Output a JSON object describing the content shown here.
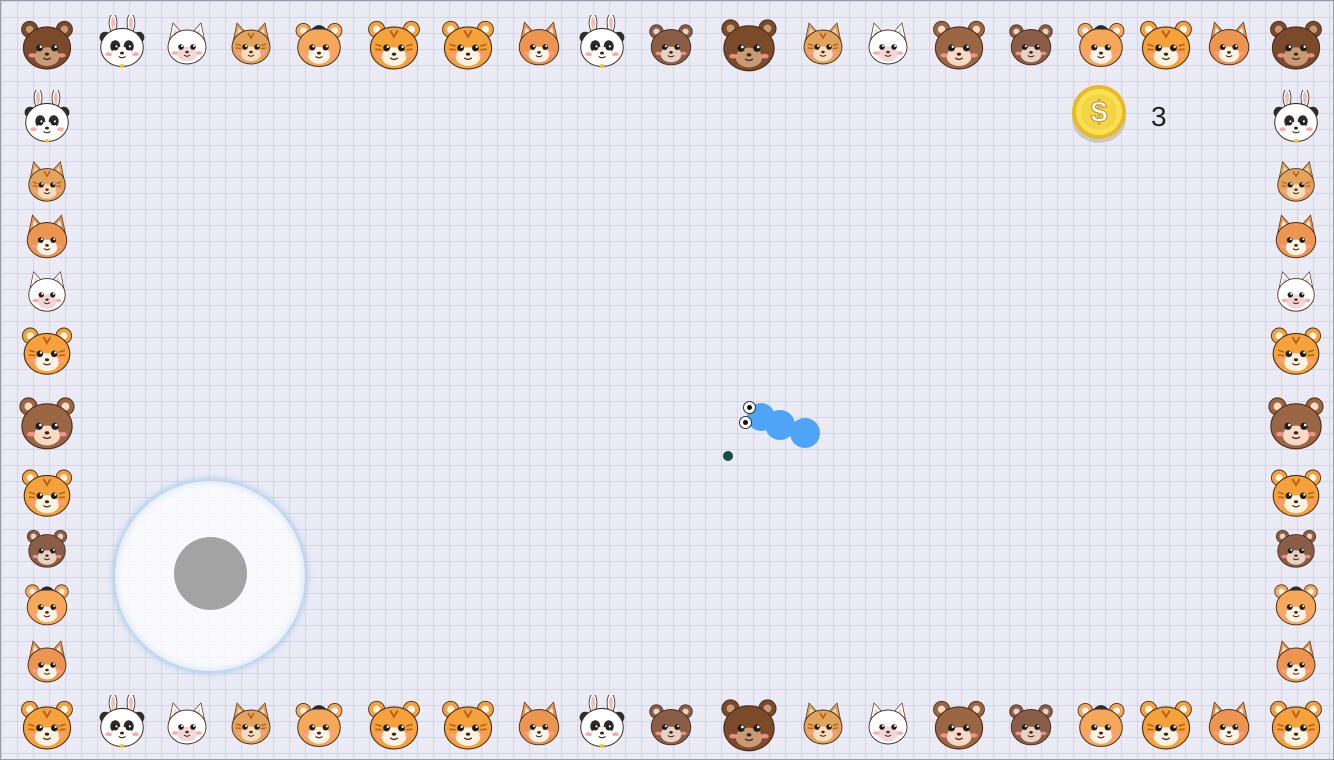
{
  "hud": {
    "coin_icon": "dollar-coin-icon",
    "coin_symbol": "$",
    "coin_count": "3"
  },
  "colors": {
    "background": "#ebebf6",
    "grid_line": "#d3d5e4",
    "snake": "#4ea4f7",
    "food": "#0e4e46",
    "joystick_knob": "#a3a3a3",
    "coin": "#f4d545"
  },
  "snake": {
    "segments": 3
  },
  "border_animals": {
    "top": [
      "bear",
      "panda-bunny",
      "white-cat",
      "tabby-cat",
      "hamster",
      "tiger",
      "tiger",
      "fox",
      "panda-bunny",
      "otter",
      "bear",
      "tabby-cat",
      "white-cat",
      "brown-bear",
      "otter",
      "hamster",
      "tiger",
      "fox",
      "bear"
    ],
    "bottom": [
      "tiger",
      "panda-bunny",
      "white-cat",
      "tabby-cat",
      "hamster",
      "tiger",
      "tiger",
      "fox",
      "panda-bunny",
      "otter",
      "bear",
      "tabby-cat",
      "white-cat",
      "brown-bear",
      "otter",
      "hamster",
      "tiger",
      "fox",
      "tiger"
    ],
    "left": [
      "panda-bunny",
      "tabby-cat",
      "fox",
      "white-cat",
      "tiger",
      "brown-bear",
      "tiger",
      "otter",
      "hamster",
      "fox"
    ],
    "right": [
      "panda-bunny",
      "tabby-cat",
      "fox",
      "white-cat",
      "tiger",
      "brown-bear",
      "tiger",
      "otter",
      "hamster",
      "fox"
    ]
  },
  "animal_palette": {
    "bear": {
      "fur": "#7a4a2a",
      "inner": "#c89b74"
    },
    "brown-bear": {
      "fur": "#9b6644",
      "inner": "#fbd9c4"
    },
    "panda-bunny": {
      "fur": "#ffffff",
      "inner": "#2c2c2c",
      "ears": "#f5b9b5"
    },
    "white-cat": {
      "fur": "#ffffff",
      "inner": "#f2d6d6"
    },
    "tabby-cat": {
      "fur": "#e2a35c",
      "inner": "#f8dcbc"
    },
    "hamster": {
      "fur": "#f5a85a",
      "inner": "#fff2e4",
      "cap": "#2a2a2a"
    },
    "tiger": {
      "fur": "#f6a23c",
      "inner": "#fff2e0"
    },
    "fox": {
      "fur": "#ec9550",
      "inner": "#fff3e6"
    },
    "otter": {
      "fur": "#8a5d47",
      "inner": "#e9d2c2"
    }
  }
}
